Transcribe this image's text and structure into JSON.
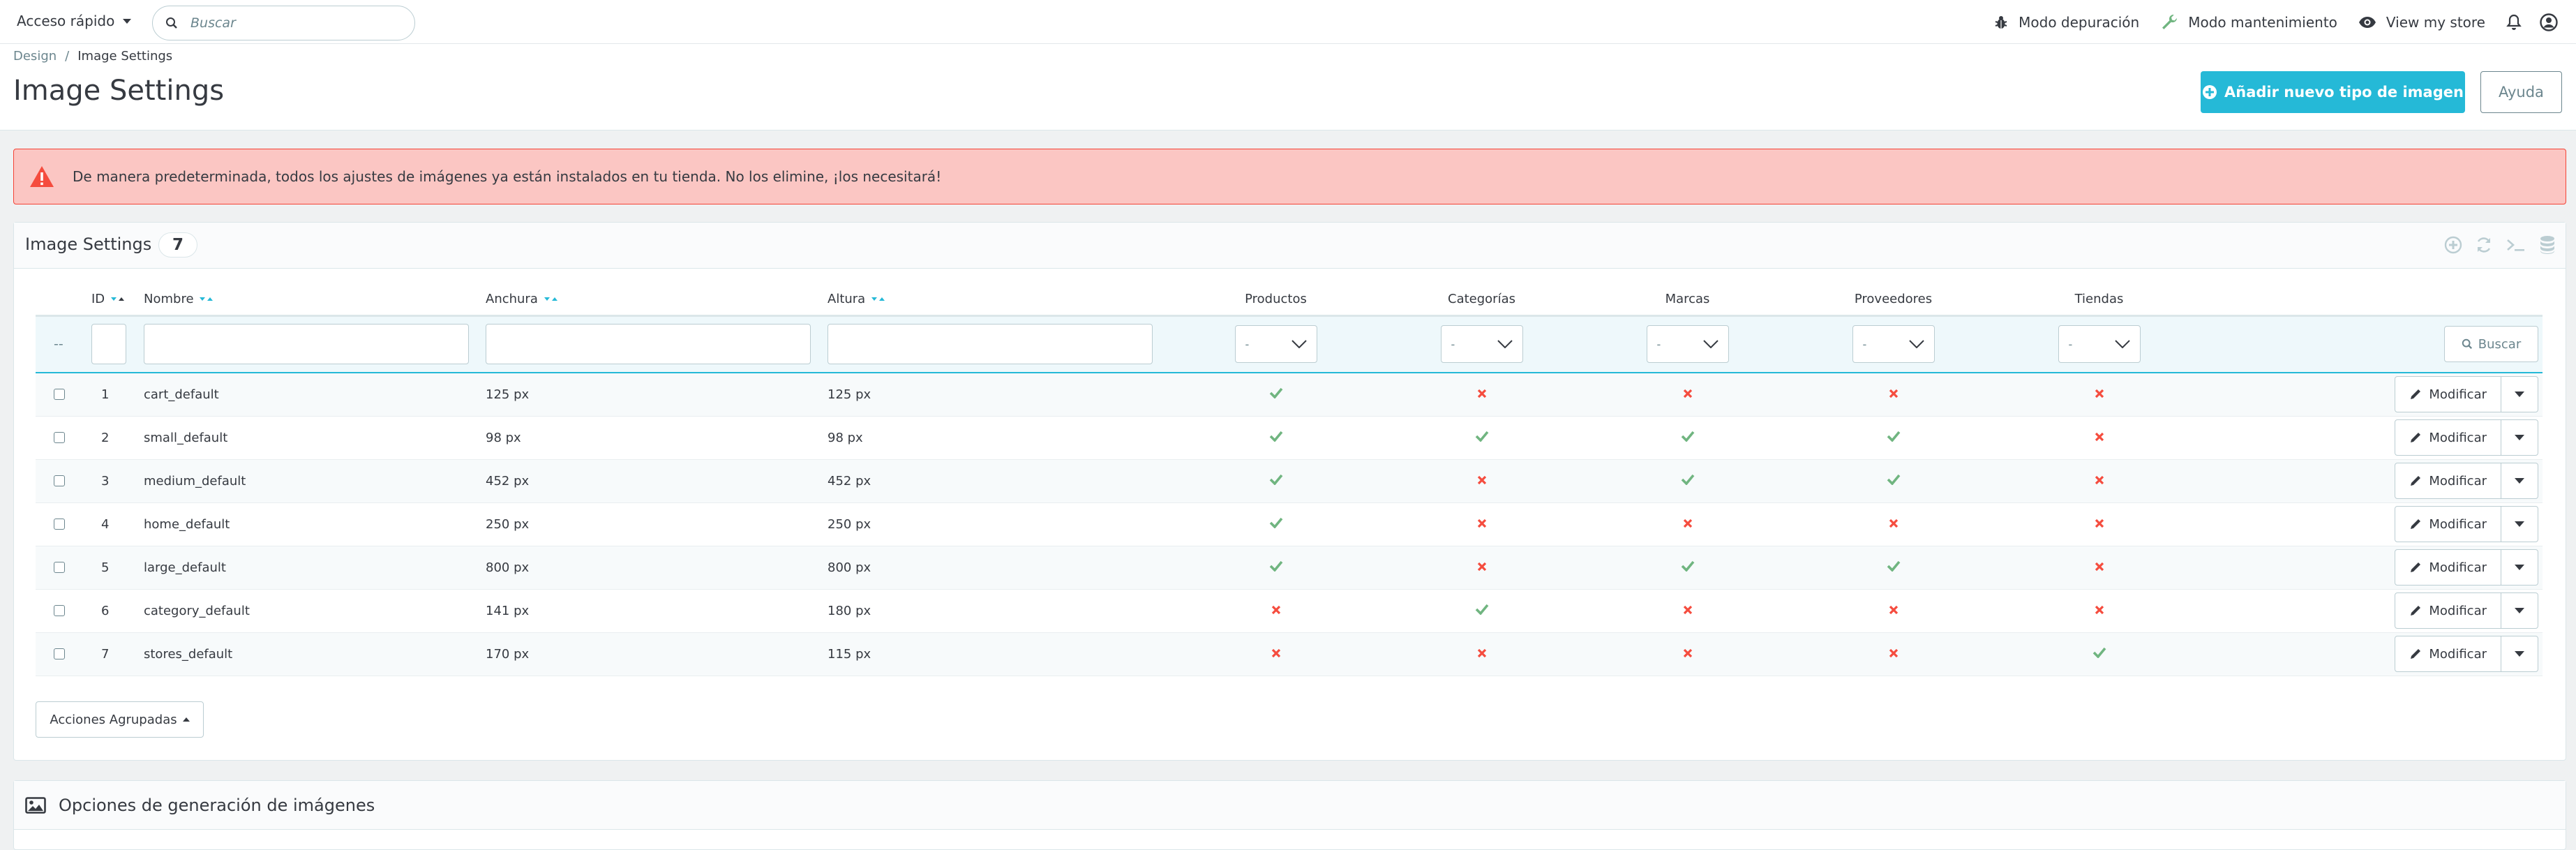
{
  "header": {
    "quick_access": "Acceso rápido",
    "search_placeholder": "Buscar",
    "debug_mode": "Modo depuración",
    "maintenance_mode": "Modo mantenimiento",
    "view_store": "View my store"
  },
  "breadcrumb": {
    "parent": "Design",
    "separator": "/",
    "current": "Image Settings"
  },
  "page": {
    "title": "Image Settings",
    "add_button": "Añadir nuevo tipo de imagen",
    "help_button": "Ayuda"
  },
  "alert": {
    "message": "De manera predeterminada, todos los ajustes de imágenes ya están instalados en tu tienda. No los elimine, ¡los necesitará!"
  },
  "panel": {
    "title": "Image Settings",
    "count": "7",
    "columns": {
      "id": "ID",
      "name": "Nombre",
      "width": "Anchura",
      "height": "Altura",
      "products": "Productos",
      "categories": "Categorías",
      "brands": "Marcas",
      "suppliers": "Proveedores",
      "stores": "Tiendas"
    },
    "filter": {
      "select_placeholder": "-",
      "bulk_marker": "--",
      "search_button": "Buscar"
    },
    "row_action": "Modificar",
    "rows": [
      {
        "id": "1",
        "name": "cart_default",
        "width": "125 px",
        "height": "125 px"
      },
      {
        "id": "2",
        "name": "small_default",
        "width": "98 px",
        "height": "98 px"
      },
      {
        "id": "3",
        "name": "medium_default",
        "width": "452 px",
        "height": "452 px"
      },
      {
        "id": "4",
        "name": "home_default",
        "width": "250 px",
        "height": "250 px"
      },
      {
        "id": "5",
        "name": "large_default",
        "width": "800 px",
        "height": "800 px"
      },
      {
        "id": "6",
        "name": "category_default",
        "width": "141 px",
        "height": "180 px"
      },
      {
        "id": "7",
        "name": "stores_default",
        "width": "170 px",
        "height": "115 px"
      }
    ],
    "bulk_actions": "Acciones Agrupadas"
  },
  "panel2": {
    "title": "Opciones de generación de imágenes"
  },
  "colors": {
    "accent": "#25b9d7",
    "success": "#70b580",
    "danger": "#f54c3e",
    "alert_bg": "#fbc6c3"
  },
  "icons": [
    "search-icon",
    "bug-icon",
    "wrench-icon",
    "eye-icon",
    "bell-icon",
    "user-icon",
    "plus-circle-icon",
    "warning-icon",
    "check-icon",
    "cross-icon",
    "pencil-icon",
    "chevron-down-icon",
    "image-icon",
    "database-icon",
    "terminal-icon",
    "refresh-icon"
  ]
}
